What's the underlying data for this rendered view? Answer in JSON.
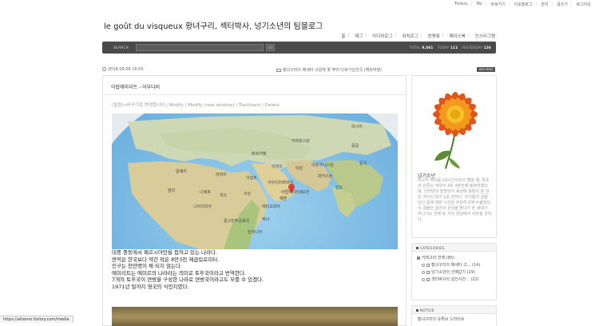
{
  "topbar": {
    "items": [
      "Tistory",
      "My",
      "바로가기",
      "이웃블로그",
      "관리",
      "글쓰기",
      "로그아웃"
    ]
  },
  "blog": {
    "title": "le goût du visqueux 황녀구리, 섹터박사, 넝기소년의 팀블로그"
  },
  "nav": {
    "items": [
      "홈",
      "태그",
      "미디어로그",
      "위치로그",
      "방명록",
      "페이스북",
      "인스타그램"
    ]
  },
  "search": {
    "label": "SEARCH",
    "button": "GO",
    "placeholder": ""
  },
  "stats": {
    "total_label": "TOTAL",
    "total": "9,061",
    "today_label": "TODAY",
    "today": "111",
    "yesterday_label": "YESTERDAY",
    "yesterday": "126"
  },
  "post": {
    "date": "2018.09.06 16:55",
    "category": "황녀구리의 메세타 고원에 꽃 뿌리기/호기심천국 (해외여행)",
    "rss": "RSS FEED",
    "title": "아랍에미리트 - 어부다비",
    "links": "(알람)→바꾸기로 변경합니다 | Modify | Modify (new window) | Trackback | Delete",
    "body": [
      "대중 중동에서 페르시아만을 접하고 있는 나라다.",
      "면적은 한국보다 약간 작은 8만3천 제곱킬로미터.",
      "인구는 천만명이 채 되지 않는다.",
      "에미리트는 에미르의 나라라는 의미로 토후국이라고 번역한다.",
      "7개의 토후국이 연방을 구성한 나라로 연방국이라고도 부를 수 있겠다.",
      "1971년 탈까지 영국의 식민지였다."
    ]
  },
  "profile": {
    "name": "넝기소년",
    "description": "지구의 역사를 24시간이라고 했을 때, 최초의 인류는 겨우의 4초 4분전에 출현하였으며, 인터넷의 발명되어 세상에 보편이 된 것은 겨우이 되기 2초 전이다. 우리들이 글을 남긴 중에 대한 시간은 우런히 0에 수렴한다. 이 결물은 잡건의 관심을 받다가 한 세대가 지나기도 전에 또 우의 관심에서 사라질 것이다."
  },
  "categories": {
    "header": "CATEGORIES",
    "items": [
      {
        "label": "카테고리 전체 (85)",
        "level": 0
      },
      {
        "label": "황녀구리의 메세타 고... (14)",
        "level": 1
      },
      {
        "label": "넝기소년의 선배갑기 (29)",
        "level": 1
      },
      {
        "label": "섹터박사의 살인사건... (22)",
        "level": 1
      }
    ]
  },
  "notice": {
    "header": "NOTICE",
    "items": [
      "황녀구리의 유튜브 드라이브"
    ]
  },
  "statusbar": {
    "url": "https://altsimo.tistory.com/media"
  },
  "map": {
    "labels": [
      "러시아",
      "카자흐스탄",
      "몽골",
      "튀르키예",
      "이란",
      "이라크",
      "아프가니스탄",
      "파키스탄",
      "이집트",
      "리비아",
      "알제리",
      "사우디아라비아",
      "인도",
      "중국",
      "말리",
      "니제르",
      "수단",
      "차드",
      "나이지리아",
      "에티오피아",
      "케냐",
      "콩고민주공화국",
      "탄자니아",
      "오만",
      "예멘",
      "아랍에미리트"
    ]
  }
}
